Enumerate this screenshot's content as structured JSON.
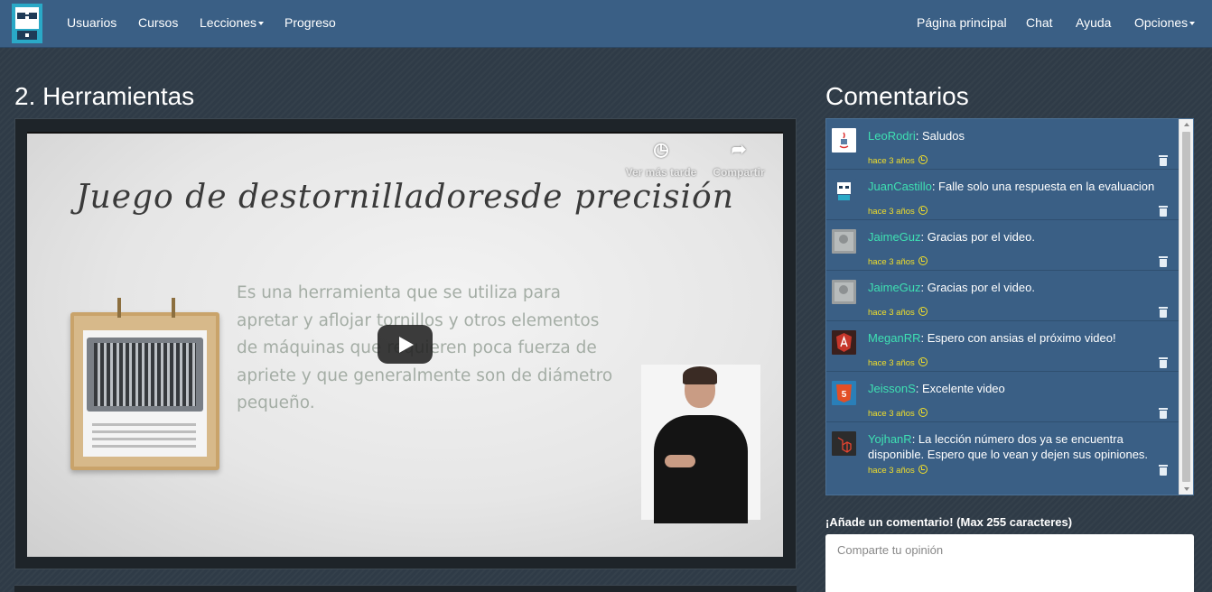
{
  "nav": {
    "left": [
      {
        "label": "Usuarios"
      },
      {
        "label": "Cursos"
      },
      {
        "label": "Lecciones"
      },
      {
        "label": "Progreso"
      }
    ],
    "right": [
      {
        "label": "Página principal"
      },
      {
        "label": "Chat"
      },
      {
        "label": "Ayuda"
      },
      {
        "label": "Opciones"
      }
    ]
  },
  "lesson": {
    "title": "2. Herramientas"
  },
  "video": {
    "slide_title": "Juego de destornilladoresde precisión",
    "slide_body": "Es una herramienta que se utiliza para apretar y aflojar tornillos y otros elementos de máquinas que requieren poca fuerza de apriete y que generalmente son de diámetro pequeño.",
    "watch_later_label": "Ver más tarde",
    "share_label": "Compartir",
    "icons": {
      "watch_later": "clock-icon",
      "share": "share-icon",
      "play": "play-icon"
    }
  },
  "comments": {
    "heading": "Comentarios",
    "items": [
      {
        "user": "LeoRodri",
        "text": ": Saludos",
        "time": "hace 3 años",
        "avatar": "java-logo"
      },
      {
        "user": "JuanCastillo",
        "text": ": Falle solo una respuesta en la evaluacion",
        "time": "hace 3 años",
        "avatar": "robot-logo"
      },
      {
        "user": "JaimeGuz",
        "text": ": Gracias por el video.",
        "time": "hace 3 años",
        "avatar": "photo"
      },
      {
        "user": "JaimeGuz",
        "text": ": Gracias por el video.",
        "time": "hace 3 años",
        "avatar": "photo"
      },
      {
        "user": "MeganRR",
        "text": ": Espero con ansias el próximo video!",
        "time": "hace 3 años",
        "avatar": "angular-logo"
      },
      {
        "user": "JeissonS",
        "text": ": Excelente video",
        "time": "hace 3 años",
        "avatar": "html5-logo"
      },
      {
        "user": "YojhanR",
        "text": ": La lección número dos ya se encuentra disponible. Espero que lo vean y dejen sus opiniones.",
        "time": "hace 3 años",
        "avatar": "laravel-logo"
      }
    ]
  },
  "add_comment": {
    "label": "¡Añade un comentario! (Max 255 caracteres)",
    "placeholder": "Comparte tu opinión"
  },
  "colors": {
    "navbar": "#3a5f85",
    "username": "#3ee0b2",
    "timestamp": "#f2df2a"
  }
}
